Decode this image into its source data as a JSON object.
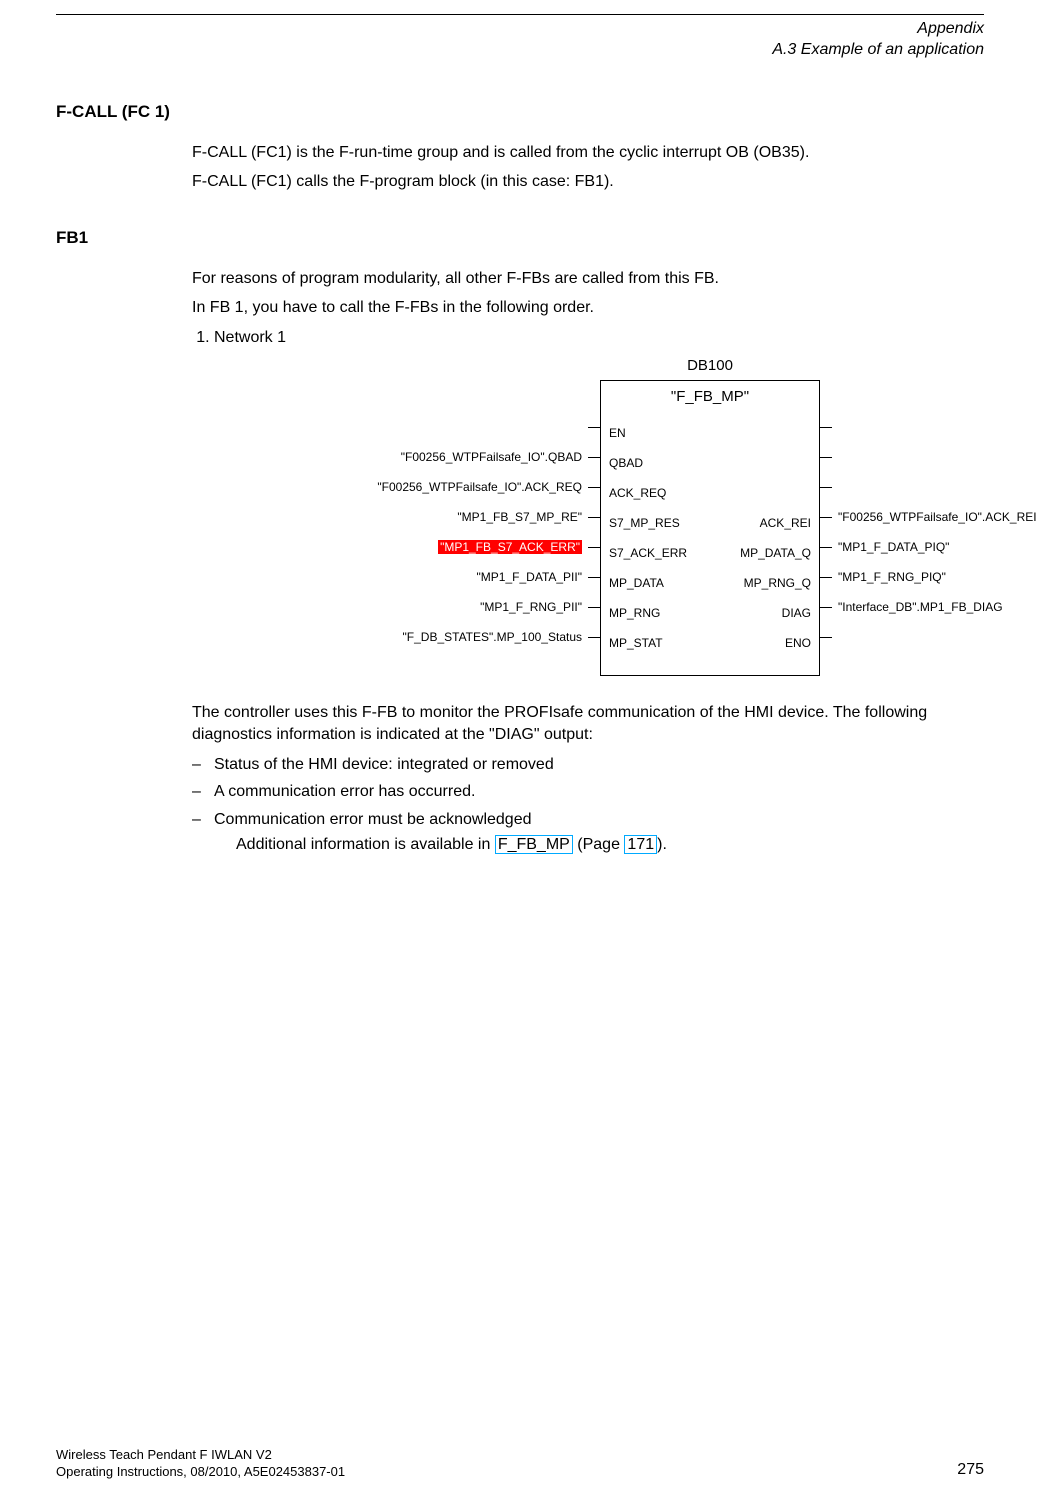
{
  "header": {
    "chapter": "Appendix",
    "section": "A.3 Example of an application"
  },
  "s1": {
    "title": "F-CALL (FC 1)",
    "p1": "F-CALL (FC1) is the F-run-time group and is called from the cyclic interrupt OB (OB35).",
    "p2": "F-CALL (FC1) calls the F-program block (in this case: FB1)."
  },
  "s2": {
    "title": "FB1",
    "p1": "For reasons of program modularity, all other F-FBs are called from this FB.",
    "p2": "In FB 1, you have to call the F-FBs in the following order.",
    "li1": "Network 1",
    "p3": "The controller uses this F-FB to monitor the PROFIsafe communication of the HMI device. The following diagnostics information is indicated at the \"DIAG\" output:",
    "d1": "Status of the HMI device: integrated or removed",
    "d2": "A communication error has occurred.",
    "d3": "Communication error must be acknowledged",
    "p4a": "Additional information is available in ",
    "p4link1": "F_FB_MP",
    "p4b": " (Page ",
    "p4link2": "171",
    "p4c": ")."
  },
  "diagram": {
    "db": "DB100",
    "block_name": "\"F_FB_MP\"",
    "left_ports": [
      "EN",
      "QBAD",
      "ACK_REQ",
      "S7_MP_RES",
      "S7_ACK_ERR",
      "MP_DATA",
      "MP_RNG",
      "MP_STAT"
    ],
    "right_ports": [
      "",
      "",
      "",
      "ACK_REI",
      "MP_DATA_Q",
      "MP_RNG_Q",
      "DIAG",
      "ENO"
    ],
    "left_ext": [
      "",
      "\"F00256_WTPFailsafe_IO\".QBAD",
      "\"F00256_WTPFailsafe_IO\".ACK_REQ",
      "\"MP1_FB_S7_MP_RE\"",
      "\"MP1_FB_S7_ACK_ERR\"",
      "\"MP1_F_DATA_PII\"",
      "\"MP1_F_RNG_PII\"",
      "\"F_DB_STATES\".MP_100_Status"
    ],
    "right_ext": [
      "",
      "",
      "",
      "\"F00256_WTPFailsafe_IO\".ACK_REI",
      "\"MP1_F_DATA_PIQ\"",
      "\"MP1_F_RNG_PIQ\"",
      "\"Interface_DB\".MP1_FB_DIAG",
      ""
    ],
    "highlight_left_index": 4
  },
  "footer": {
    "line1": "Wireless Teach Pendant F IWLAN V2",
    "line2": "Operating Instructions, 08/2010, A5E02453837-01",
    "page": "275"
  }
}
